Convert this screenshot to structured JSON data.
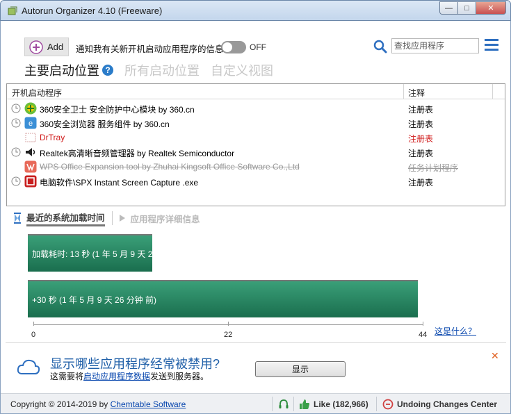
{
  "window": {
    "title": "Autorun Organizer 4.10 (Freeware)",
    "minimize_glyph": "—",
    "maximize_glyph": "□",
    "close_glyph": "✕"
  },
  "toolbar": {
    "add_label": "Add",
    "notify_text": "通知我有关新开机启动应用程序的信息",
    "toggle_state": "OFF",
    "search_placeholder": "查找应用程序"
  },
  "view_tabs": {
    "main": "主要启动位置",
    "help_glyph": "?",
    "all": "所有启动位置",
    "custom": "自定义视图"
  },
  "list": {
    "columns": [
      "开机启动程序",
      "注释"
    ],
    "rows": [
      {
        "name": "360安全卫士 安全防护中心模块 by 360.cn",
        "note": "注册表",
        "state": "normal",
        "clock": true
      },
      {
        "name": "360安全浏览器 服务组件 by 360.cn",
        "note": "注册表",
        "state": "normal",
        "clock": true
      },
      {
        "name": "DrTray",
        "note": "注册表",
        "state": "red",
        "clock": false
      },
      {
        "name": "Realtek高清晰音频管理器 by Realtek Semiconductor",
        "note": "注册表",
        "state": "normal",
        "clock": true
      },
      {
        "name": "WPS Office Expansion tool by Zhuhai Kingsoft Office Software Co.,Ltd",
        "note": "任务计划程序",
        "state": "disabled",
        "clock": false
      },
      {
        "name": "电脑软件\\SPX Instant Screen Capture .exe",
        "note": "注册表",
        "state": "normal",
        "clock": true
      }
    ]
  },
  "lower_tabs": {
    "recent": "最近的系统加载时间",
    "details": "应用程序详细信息"
  },
  "chart_data": {
    "type": "bar",
    "orientation": "horizontal",
    "bars": [
      {
        "label": "加载耗时: 13 秒 (1 年 5 月 9 天 2...",
        "value": 13
      },
      {
        "label": "+30 秒 (1 年 5 月 9 天 26 分钟 前)",
        "value": 43
      }
    ],
    "ticks": [
      "0",
      "22",
      "44"
    ],
    "xlim": [
      0,
      44
    ],
    "color": "#1f7a56"
  },
  "chart_link": "这是什么？",
  "promo": {
    "title": "显示哪些应用程序经常被禁用?",
    "sub_prefix": "这需要将",
    "sub_link": "启动应用程序数据",
    "sub_suffix": "发送到服务器。",
    "button": "显示",
    "dismiss_glyph": "✕"
  },
  "status": {
    "copyright": "Copyright © 2014-2019 by ",
    "company": "Chemtable Software",
    "like": "Like (182,966)",
    "undo": "Undoing Changes Center"
  }
}
